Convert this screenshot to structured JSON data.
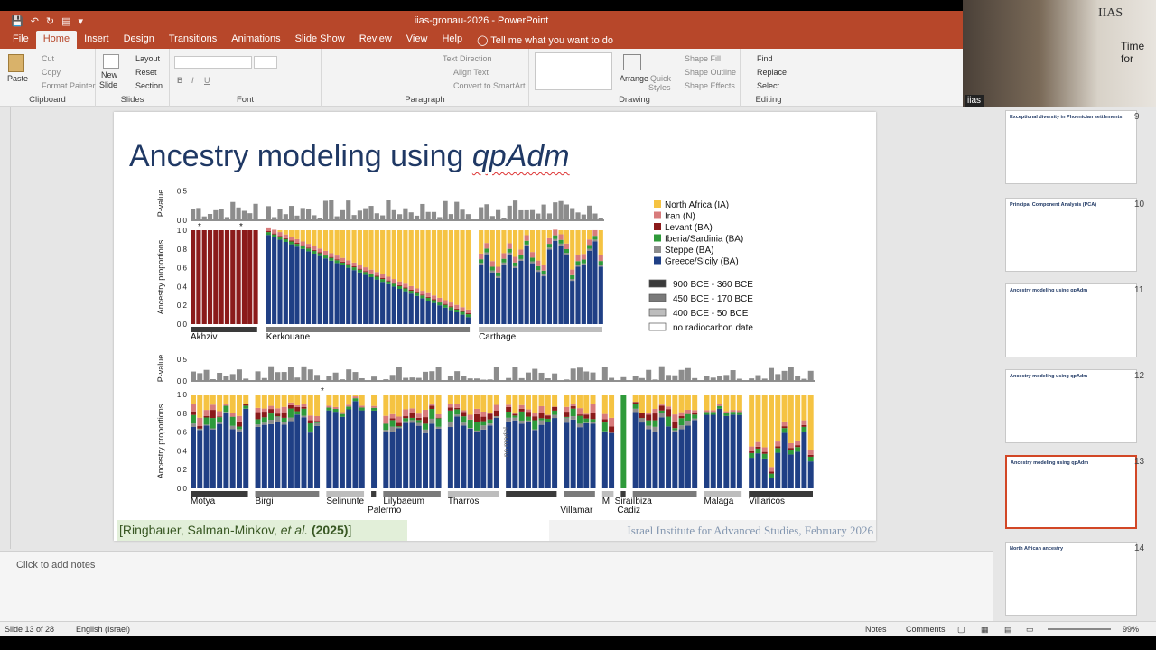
{
  "window": {
    "title": "iias-gronau-2026  -  PowerPoint"
  },
  "menu": {
    "tabs": [
      "File",
      "Home",
      "Insert",
      "Design",
      "Transitions",
      "Animations",
      "Slide Show",
      "Review",
      "View",
      "Help"
    ],
    "tell": "Tell me what you want to do"
  },
  "ribbon": {
    "clipboard": {
      "paste": "Paste",
      "cut": "Cut",
      "copy": "Copy",
      "format_painter": "Format Painter",
      "label": "Clipboard"
    },
    "slides": {
      "new_slide_1": "New",
      "new_slide_2": "Slide",
      "layout": "Layout",
      "reset": "Reset",
      "section": "Section",
      "label": "Slides"
    },
    "font": {
      "label": "Font"
    },
    "paragraph": {
      "text_direction": "Text Direction",
      "align_text": "Align Text",
      "convert": "Convert to SmartArt",
      "label": "Paragraph"
    },
    "drawing": {
      "arrange": "Arrange",
      "quick_styles_1": "Quick",
      "quick_styles_2": "Styles",
      "shape_fill": "Shape Fill",
      "shape_outline": "Shape Outline",
      "shape_effects": "Shape Effects",
      "label": "Drawing"
    },
    "editing": {
      "find": "Find",
      "replace": "Replace",
      "select": "Select",
      "label": "Editing"
    }
  },
  "camera": {
    "tag": "iias",
    "logo_1": "IIAS",
    "logo_2": "IIAS",
    "sign": "Time for"
  },
  "slide": {
    "title_plain": "Ancestry modeling using ",
    "title_italic": "qpAdm",
    "citation_open": "[Ringbauer, Salman-Minkov, ",
    "citation_italic": "et al.",
    "citation_year": " (2025)",
    "citation_close": "]",
    "institute": "Israel Institute for Advanced Studies, February 2026"
  },
  "chart_data": {
    "type": "bar",
    "ylabel_pvalue": "P-value",
    "ylabel_prop": "Ancestry proportions",
    "pvalue_ticks": [
      "0.5",
      "0.0"
    ],
    "prop_ticks": [
      "1.0",
      "0.8",
      "0.6",
      "0.4",
      "0.2",
      "0.0"
    ],
    "legend_ancestry": [
      {
        "name": "North Africa (IA)",
        "color": "#f5c342"
      },
      {
        "name": "Iran (N)",
        "color": "#d87b7b"
      },
      {
        "name": "Levant (BA)",
        "color": "#8b1a1a"
      },
      {
        "name": "Iberia/Sardinia (BA)",
        "color": "#2e9a3a"
      },
      {
        "name": "Steppe (BA)",
        "color": "#8c8c8c"
      },
      {
        "name": "Greece/Sicily (BA)",
        "color": "#1f3f85"
      }
    ],
    "legend_dates": [
      {
        "name": "900 BCE - 360 BCE",
        "color": "#3a3a3a"
      },
      {
        "name": "450 BCE - 170 BCE",
        "color": "#7a7a7a"
      },
      {
        "name": "400 BCE - 50 BCE",
        "color": "#bdbdbd"
      },
      {
        "name": "no radiocarbon date",
        "color": "#ffffff"
      }
    ],
    "top_sites": [
      {
        "name": "Akhziv",
        "n": 12,
        "profile": "levant"
      },
      {
        "name": "Kerkouane",
        "n": 36,
        "profile": "kerkouane"
      },
      {
        "name": "Carthage",
        "n": 22,
        "profile": "carthage"
      }
    ],
    "bottom_sites": [
      {
        "name": "Motya",
        "n": 9,
        "profile": "mixed"
      },
      {
        "name": "Birgi",
        "n": 10,
        "profile": "mixed"
      },
      {
        "name": "Selinunte",
        "n": 6,
        "profile": "greek"
      },
      {
        "name": "Palermo",
        "n": 1,
        "profile": "greek"
      },
      {
        "name": "Lilybaeum",
        "n": 9,
        "profile": "mixed"
      },
      {
        "name": "Tharros",
        "n": 8,
        "profile": "mixed"
      },
      {
        "name": "",
        "n": 8,
        "profile": "mixed"
      },
      {
        "name": "Villamar",
        "n": 5,
        "profile": "mixed"
      },
      {
        "name": "M. Sirai",
        "n": 2,
        "profile": "mixed"
      },
      {
        "name": "Cadiz",
        "n": 1,
        "profile": "iberia"
      },
      {
        "name": "Ibiza",
        "n": 10,
        "profile": "mixed"
      },
      {
        "name": "Malaga",
        "n": 6,
        "profile": "greek"
      },
      {
        "name": "Villaricos",
        "n": 10,
        "profile": "africa"
      }
    ],
    "no_model_label": "no model",
    "star": "*"
  },
  "thumbnails": [
    {
      "num": "9",
      "title": "Exceptional diversity in Phoenician settlements"
    },
    {
      "num": "10",
      "title": "Principal Component Analysis (PCA)"
    },
    {
      "num": "11",
      "title": "Ancestry modeling using qpAdm"
    },
    {
      "num": "12",
      "title": "Ancestry modeling using qpAdm"
    },
    {
      "num": "13",
      "title": "Ancestry modeling using qpAdm"
    },
    {
      "num": "14",
      "title": "North African ancestry"
    }
  ],
  "notes": {
    "placeholder": "Click to add notes"
  },
  "status": {
    "slide": "Slide 13 of 28",
    "language": "English (Israel)",
    "notes": "Notes",
    "comments": "Comments",
    "zoom": "99%"
  }
}
